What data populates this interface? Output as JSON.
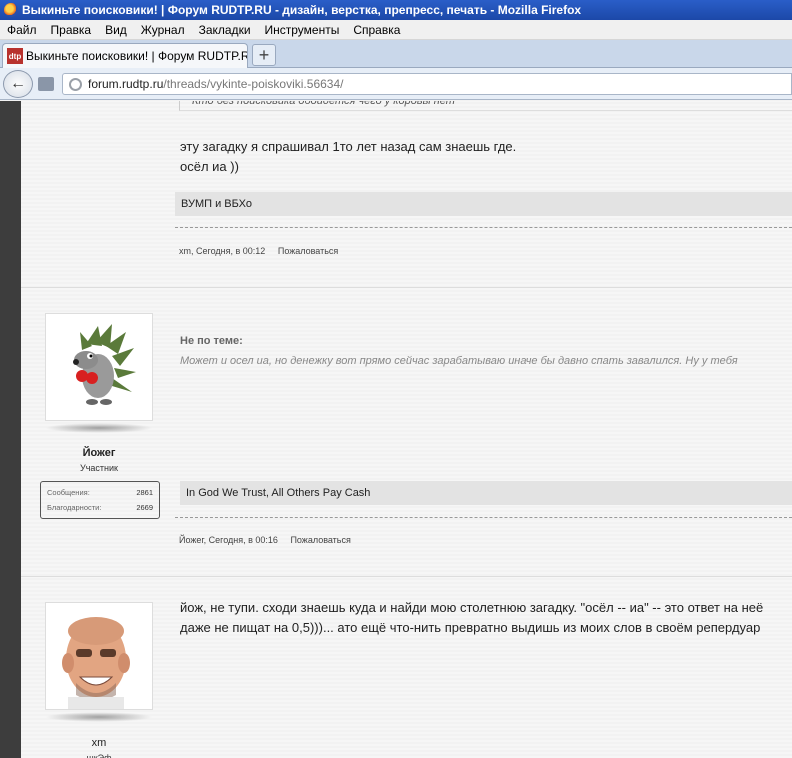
{
  "window": {
    "title": "Выкиньте поисковики! | Форум RUDTP.RU - дизайн, верстка, препресс, печать - Mozilla Firefox"
  },
  "menu": [
    "Файл",
    "Правка",
    "Вид",
    "Журнал",
    "Закладки",
    "Инструменты",
    "Справка"
  ],
  "tab": {
    "favicon_text": "dtp",
    "label": "Выкиньте поисковики! | Форум RUDTP.RU...",
    "new_tab": "+"
  },
  "nav": {
    "url_host": "forum.rudtp.ru",
    "url_path": "/threads/vykinte-poiskoviki.56634/"
  },
  "posts": [
    {
      "quote": "Кто без поисковика обойдется чего у коровы нет",
      "lines": [
        "эту загадку я спрашивал 1то лет назад сам знаешь где.",
        "осёл иа ))"
      ],
      "signature": "ВУМП и ВБХо",
      "author": "xm",
      "time": "Сегодня, в 00:12",
      "report": "Пожаловаться"
    },
    {
      "user": "Йожег",
      "role": "Участник",
      "stats": [
        {
          "label": "Сообщения:",
          "value": "2861"
        },
        {
          "label": "Благодарности:",
          "value": "2669"
        }
      ],
      "offtopic_label": "Не по теме:",
      "offtopic_text": "Может и осел иа, но денежку вот прямо сейчас зарабатываю иначе бы давно спать завалился. Ну у тебя",
      "signature": "In God We Trust, All Others Pay Cash",
      "author": "Йожег",
      "time": "Сегодня, в 00:16",
      "report": "Пожаловаться"
    },
    {
      "user": "xm",
      "role": "шкЭф",
      "lines": [
        "йож, не тупи. сходи знаешь куда и найди мою столетнюю загадку. \"осёл -- иа\" -- это ответ на неё",
        "даже не пищат на 0,5)))... ато ещё что-нить превратно выдишь из моих слов в своём репердуар"
      ]
    }
  ]
}
